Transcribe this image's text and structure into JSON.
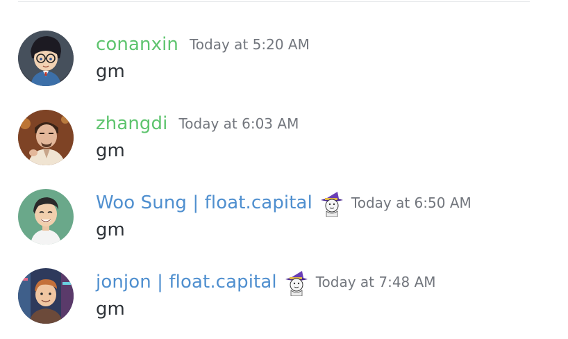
{
  "colors": {
    "green_name": "#5ec46e",
    "blue_name": "#4f8fcf",
    "timestamp": "#72767d",
    "text": "#2e3338"
  },
  "messages": [
    {
      "username": "conanxin",
      "name_color": "#5ec46e",
      "timestamp": "Today at 5:20 AM",
      "content": "gm",
      "avatar_icon": "conan-avatar-icon",
      "badge": null
    },
    {
      "username": "zhangdi",
      "name_color": "#5ec46e",
      "timestamp": "Today at 6:03 AM",
      "content": "gm",
      "avatar_icon": "zhangdi-avatar-icon",
      "badge": null
    },
    {
      "username": "Woo Sung | float.capital",
      "name_color": "#4f8fcf",
      "timestamp": "Today at 6:50 AM",
      "content": "gm",
      "avatar_icon": "woosung-avatar-icon",
      "badge": "wizard-hat-badge-icon"
    },
    {
      "username": "jonjon | float.capital",
      "name_color": "#4f8fcf",
      "timestamp": "Today at 7:48 AM",
      "content": "gm",
      "avatar_icon": "jonjon-avatar-icon",
      "badge": "wizard-hat-badge-icon"
    }
  ]
}
